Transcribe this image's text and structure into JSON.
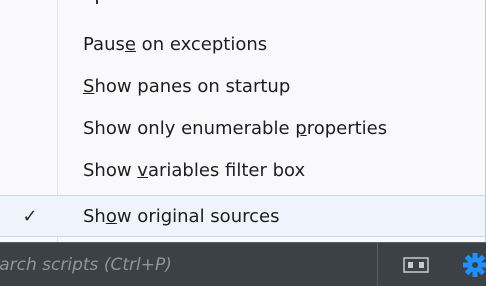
{
  "menu": {
    "items": [
      {
        "pre": "Paus",
        "mnemonic": "e",
        "post": " on exceptions",
        "checked": false
      },
      {
        "pre": "",
        "mnemonic": "S",
        "post": "how panes on startup",
        "checked": false
      },
      {
        "pre": "Show only enumerable ",
        "mnemonic": "p",
        "post": "roperties",
        "checked": false
      },
      {
        "pre": "Show ",
        "mnemonic": "v",
        "post": "ariables filter box",
        "checked": false
      },
      {
        "pre": "Sh",
        "mnemonic": "o",
        "post": "w original sources",
        "checked": true
      }
    ],
    "check_glyph": "✓"
  },
  "toolbar": {
    "search": {
      "placeholder": "Search scripts (Ctrl+P)"
    },
    "pane_icon": "toggle-panes-icon",
    "gear_icon": "gear-icon",
    "accent_color": "#1e90ff"
  }
}
